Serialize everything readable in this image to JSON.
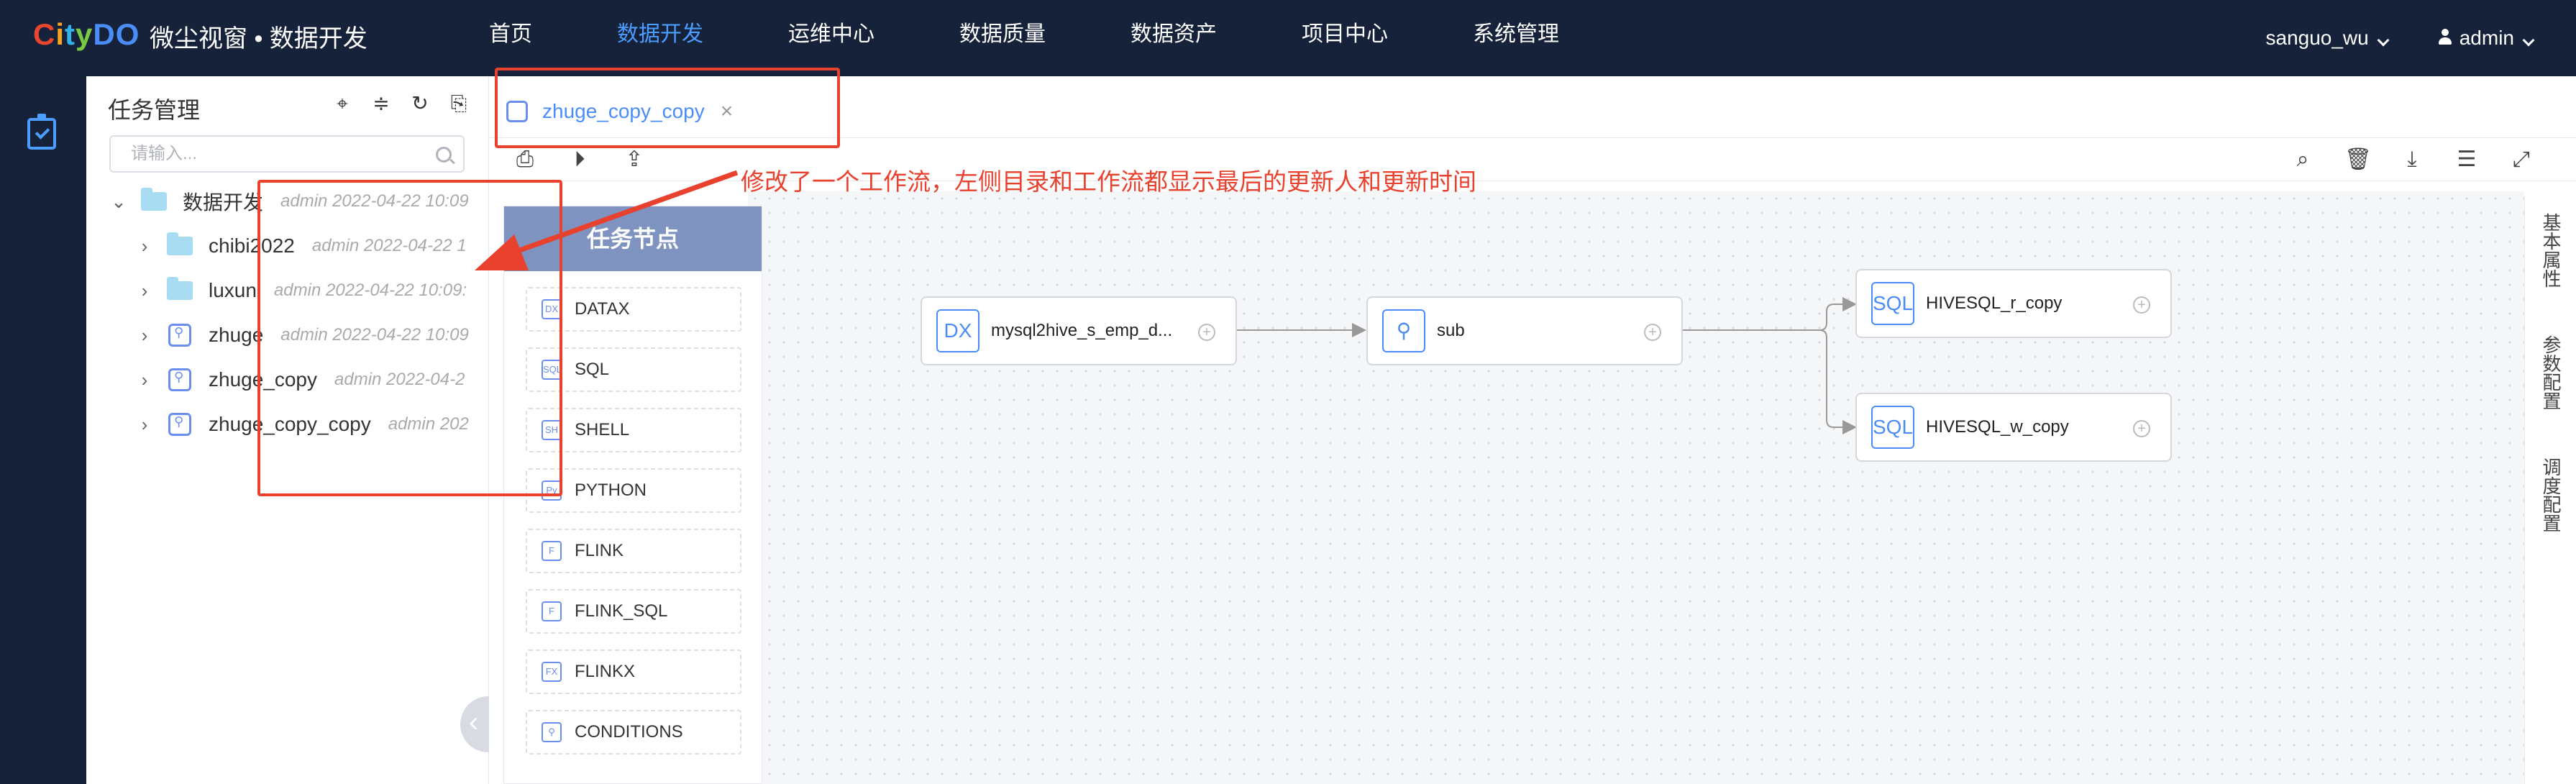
{
  "topbar": {
    "logo_letters": [
      "C",
      "i",
      "t",
      "y",
      "DO"
    ],
    "app_title": "微尘视窗 • 数据开发",
    "nav": [
      "首页",
      "数据开发",
      "运维中心",
      "数据质量",
      "数据资产",
      "项目中心",
      "系统管理"
    ],
    "active_nav": "数据开发",
    "project": "sanguo_wu",
    "user": "admin"
  },
  "tree": {
    "title": "任务管理",
    "search_placeholder": "请输入...",
    "rows": [
      {
        "name": "数据开发",
        "meta": "admin  2022-04-22 10:09",
        "type": "folder",
        "expanded": true
      },
      {
        "name": "chibi2022",
        "meta": "admin  2022-04-22 1",
        "type": "folder"
      },
      {
        "name": "luxun",
        "meta": "admin  2022-04-22 10:09:",
        "type": "folder"
      },
      {
        "name": "zhuge",
        "meta": "admin  2022-04-22 10:09",
        "type": "workflow"
      },
      {
        "name": "zhuge_copy",
        "meta": "admin  2022-04-2",
        "type": "workflow"
      },
      {
        "name": "zhuge_copy_copy",
        "meta": "admin  202",
        "type": "workflow"
      }
    ]
  },
  "tab": {
    "label": "zhuge_copy_copy",
    "close": "×"
  },
  "palette": {
    "title": "任务节点",
    "items": [
      {
        "label": "DATAX",
        "icon": "DX"
      },
      {
        "label": "SQL",
        "icon": "SQL"
      },
      {
        "label": "SHELL",
        "icon": "SH"
      },
      {
        "label": "PYTHON",
        "icon": "Py"
      },
      {
        "label": "FLINK",
        "icon": "F"
      },
      {
        "label": "FLINK_SQL",
        "icon": "F"
      },
      {
        "label": "FLINKX",
        "icon": "FX"
      },
      {
        "label": "CONDITIONS",
        "icon": "⚲"
      }
    ]
  },
  "nodes": [
    {
      "label": "mysql2hive_s_emp_d...",
      "icon": "DX"
    },
    {
      "label": "sub",
      "icon": "⚲"
    },
    {
      "label": "HIVESQL_r_copy",
      "icon": "SQL"
    },
    {
      "label": "HIVESQL_w_copy",
      "icon": "SQL"
    }
  ],
  "right_rail": [
    "基本属性",
    "参数配置",
    "调度配置"
  ],
  "annotation": "修改了一个工作流，左侧目录和工作流都显示最后的更新人和更新时间",
  "colors": {
    "accent": "#4b8df8",
    "topbar": "#16223a",
    "annotation": "#e8412e"
  }
}
